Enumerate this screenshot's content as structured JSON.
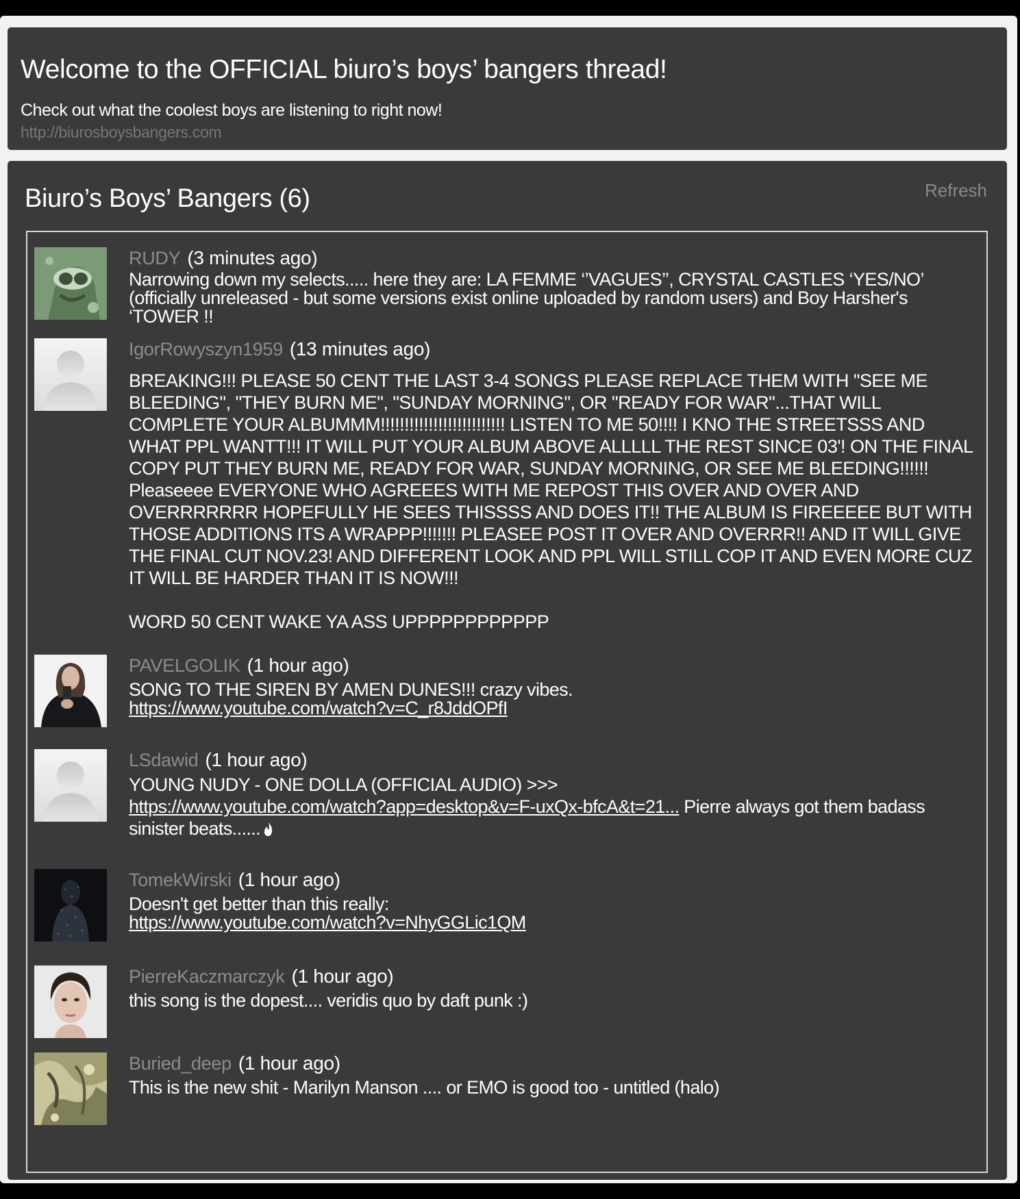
{
  "header": {
    "title": "Welcome to the OFFICIAL biuro’s boys’ bangers thread!",
    "subtitle": "Check out what the coolest boys are listening to right now!",
    "url": "http://biurosboysbangers.com"
  },
  "section": {
    "title": "Biuro’s Boys’ Bangers (6)",
    "refresh_label": "Refresh"
  },
  "posts": [
    {
      "username": "RUDY",
      "time": "(3 minutes ago)",
      "text": "Narrowing down my selects..... here they are: LA FEMME ‘’VAGUES’’, CRYSTAL CASTLES ‘YES/NO’ (officially unreleased - but some versions exist online uploaded by random users) and Boy Harsher's ‘TOWER !!",
      "avatar": "goggles-figure-icon"
    },
    {
      "username": "IgorRowyszyn1959",
      "time": "(13 minutes ago)",
      "text": "BREAKING!!! PLEASE 50 CENT THE LAST 3-4 SONGS PLEASE REPLACE THEM WITH \"SEE ME BLEEDING\", \"THEY BURN ME\", \"SUNDAY MORNING\", OR \"READY FOR WAR\"...THAT WILL COMPLETE YOUR ALBUMMM!!!!!!!!!!!!!!!!!!!!!!!!!! LISTEN TO ME 50!!!! I KNO THE STREETSSS AND WHAT PPL WANTT!!! IT WILL PUT YOUR ALBUM ABOVE ALLLLL THE REST SINCE 03'! ON THE FINAL COPY PUT THEY BURN ME, READY FOR WAR, SUNDAY MORNING, OR SEE ME BLEEDING!!!!!! Pleaseeee EVERYONE WHO AGREEES WITH ME REPOST THIS OVER AND OVER AND OVERRRRRRR HOPEFULLY HE SEES THISSSS AND DOES IT!! THE ALBUM IS FIREEEEE BUT WITH THOSE ADDITIONS ITS A WRAPPP!!!!!!! PLEASEE POST IT OVER AND OVERRR!! AND IT WILL GIVE THE FINAL CUT NOV.23! AND DIFFERENT LOOK AND PPL WILL STILL COP IT AND EVEN MORE CUZ IT WILL BE HARDER THAN IT IS NOW!!!",
      "text2": "WORD 50 CENT WAKE YA ASS UPPPPPPPPPPPP",
      "avatar": "default-user-icon"
    },
    {
      "username": "PAVELGOLIK",
      "time": "(1 hour ago)",
      "text": "SONG TO THE SIREN BY AMEN DUNES!!! crazy vibes.",
      "link": "https://www.youtube.com/watch?v=C_r8JddOPfI",
      "avatar": "person-with-phone-icon"
    },
    {
      "username": "LSdawid",
      "time": "(1 hour ago)",
      "text": "YOUNG NUDY - ONE DOLLA (OFFICIAL AUDIO) >>>",
      "link": "https://www.youtube.com/watch?app=desktop&v=F-uxQx-bfcA&t=21...",
      "text_after": " Pierre always got them badass sinister beats......",
      "emoji": "flame-icon",
      "avatar": "default-user-icon"
    },
    {
      "username": "TomekWirski",
      "time": "(1 hour ago)",
      "text": "Doesn't get better than this really:",
      "link": "https://www.youtube.com/watch?v=NhyGGLic1QM",
      "avatar": "dark-silhouette-icon"
    },
    {
      "username": "PierreKaczmarczyk",
      "time": "(1 hour ago)",
      "text": "this song is the dopest.... veridis quo by daft punk :)",
      "avatar": "portrait-face-icon"
    },
    {
      "username": "Buried_deep",
      "time": "(1 hour ago)",
      "text": "This is the new shit - Marilyn Manson .... or EMO is good too - untitled (halo)",
      "avatar": "abstract-art-icon"
    }
  ]
}
